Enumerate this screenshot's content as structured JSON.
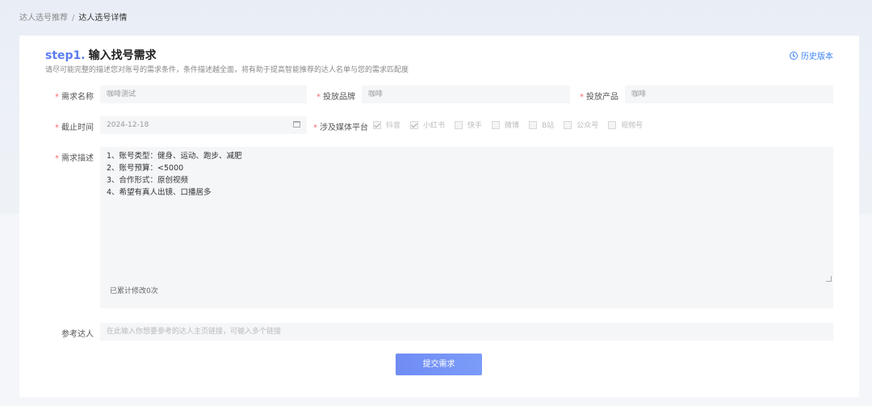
{
  "breadcrumb": {
    "parent": "达人选号推荐",
    "separator": "/",
    "current": "达人选号详情"
  },
  "header": {
    "step": "step1.",
    "title": "输入找号需求",
    "subtitle": "请尽可能完整的描述您对账号的需求条件，条件描述越全面，将有助于提高智能推荐的达人名单与您的需求匹配度",
    "history_label": "历史版本"
  },
  "form": {
    "demand_name": {
      "label": "需求名称",
      "value": "咖啡测试"
    },
    "brand": {
      "label": "投放品牌",
      "value": "咖啡"
    },
    "product": {
      "label": "投放产品",
      "value": "咖啡"
    },
    "deadline": {
      "label": "截止时间",
      "value": "2024-12-18"
    },
    "platforms": {
      "label": "涉及媒体平台",
      "options": [
        {
          "name": "抖音",
          "checked": true
        },
        {
          "name": "小红书",
          "checked": true
        },
        {
          "name": "快手",
          "checked": false
        },
        {
          "name": "微博",
          "checked": false
        },
        {
          "name": "B站",
          "checked": false
        },
        {
          "name": "公众号",
          "checked": false
        },
        {
          "name": "视频号",
          "checked": false
        }
      ]
    },
    "description": {
      "label": "需求描述",
      "lines": [
        "1、账号类型：健身、运动、跑步、减肥",
        "2、账号预算：<5000",
        "3、合作形式：原创视频",
        "4、希望有真人出镜、口播居多"
      ],
      "edit_count": "已累计修改0次"
    },
    "reference": {
      "label": "参考达人",
      "placeholder": "在此输入你想要参考的达人主页链接，可输入多个链接"
    },
    "submit_label": "提交需求"
  },
  "colors": {
    "accent": "#5b7cf0",
    "link": "#3b82f6",
    "required": "#f56c6c"
  }
}
